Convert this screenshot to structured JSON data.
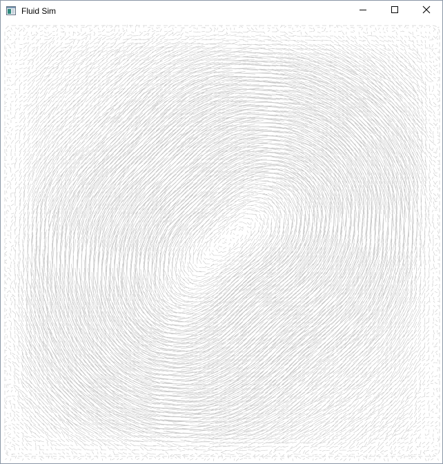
{
  "window": {
    "title": "Fluid Sim",
    "icon": "app-window-icon",
    "controls": {
      "minimize_icon": "minimize-icon",
      "maximize_icon": "maximize-icon",
      "close_icon": "close-icon"
    }
  },
  "canvas": {
    "content": "velocity-field-vector-arrows",
    "line_color": "#c8c8c8",
    "background_color": "#ffffff"
  }
}
